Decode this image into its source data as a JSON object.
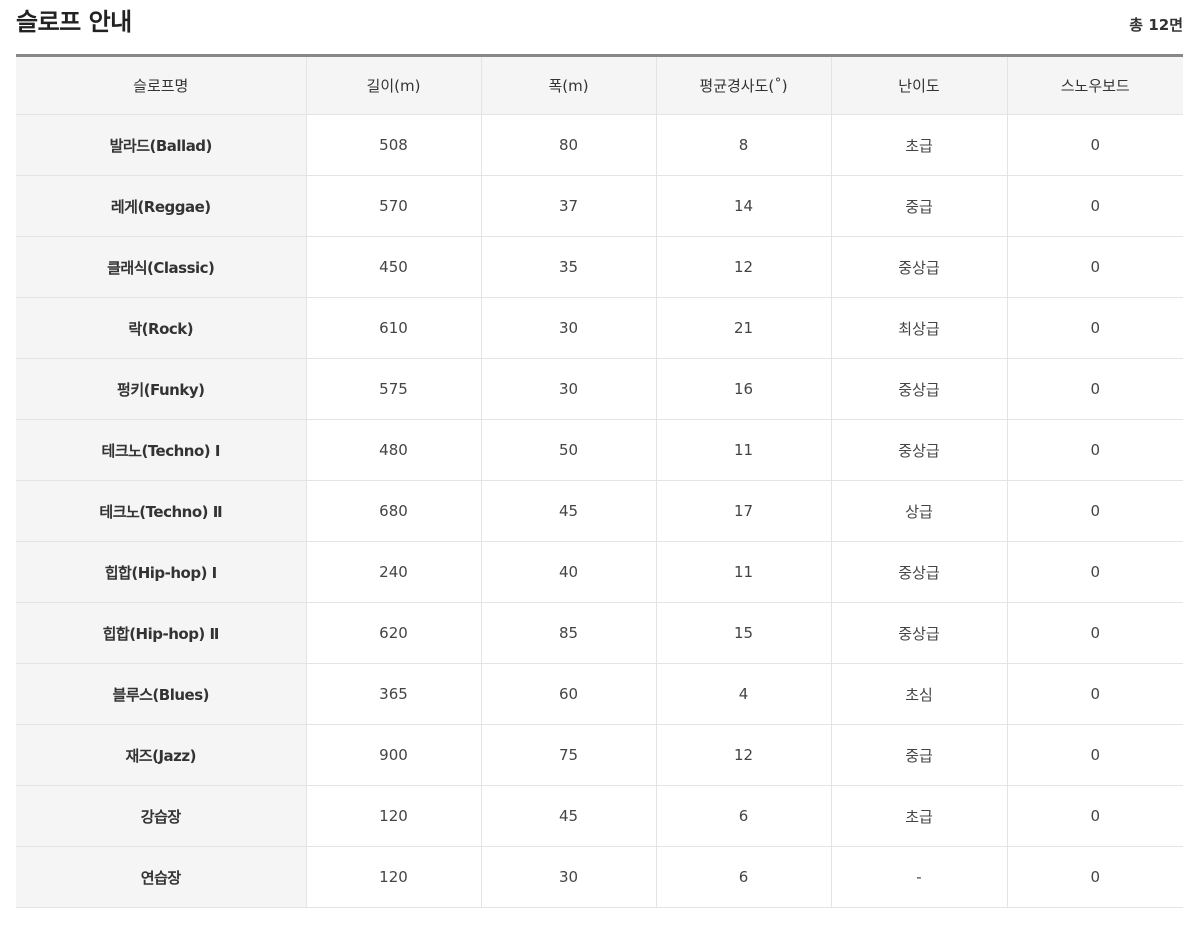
{
  "header": {
    "title": "슬로프 안내",
    "total": "총 12면"
  },
  "table": {
    "columns": [
      "슬로프명",
      "길이(m)",
      "폭(m)",
      "평균경사도(˚)",
      "난이도",
      "스노우보드"
    ],
    "rows": [
      [
        "발라드(Ballad)",
        "508",
        "80",
        "8",
        "초급",
        "0"
      ],
      [
        "레게(Reggae)",
        "570",
        "37",
        "14",
        "중급",
        "0"
      ],
      [
        "클래식(Classic)",
        "450",
        "35",
        "12",
        "중상급",
        "0"
      ],
      [
        "락(Rock)",
        "610",
        "30",
        "21",
        "최상급",
        "0"
      ],
      [
        "펑키(Funky)",
        "575",
        "30",
        "16",
        "중상급",
        "0"
      ],
      [
        "테크노(Techno) Ⅰ",
        "480",
        "50",
        "11",
        "중상급",
        "0"
      ],
      [
        "테크노(Techno) Ⅱ",
        "680",
        "45",
        "17",
        "상급",
        "0"
      ],
      [
        "힙합(Hip-hop) Ⅰ",
        "240",
        "40",
        "11",
        "중상급",
        "0"
      ],
      [
        "힙합(Hip-hop) Ⅱ",
        "620",
        "85",
        "15",
        "중상급",
        "0"
      ],
      [
        "블루스(Blues)",
        "365",
        "60",
        "4",
        "초심",
        "0"
      ],
      [
        "재즈(Jazz)",
        "900",
        "75",
        "12",
        "중급",
        "0"
      ],
      [
        "강습장",
        "120",
        "45",
        "6",
        "초급",
        "0"
      ],
      [
        "연습장",
        "120",
        "30",
        "6",
        "-",
        "0"
      ]
    ]
  }
}
